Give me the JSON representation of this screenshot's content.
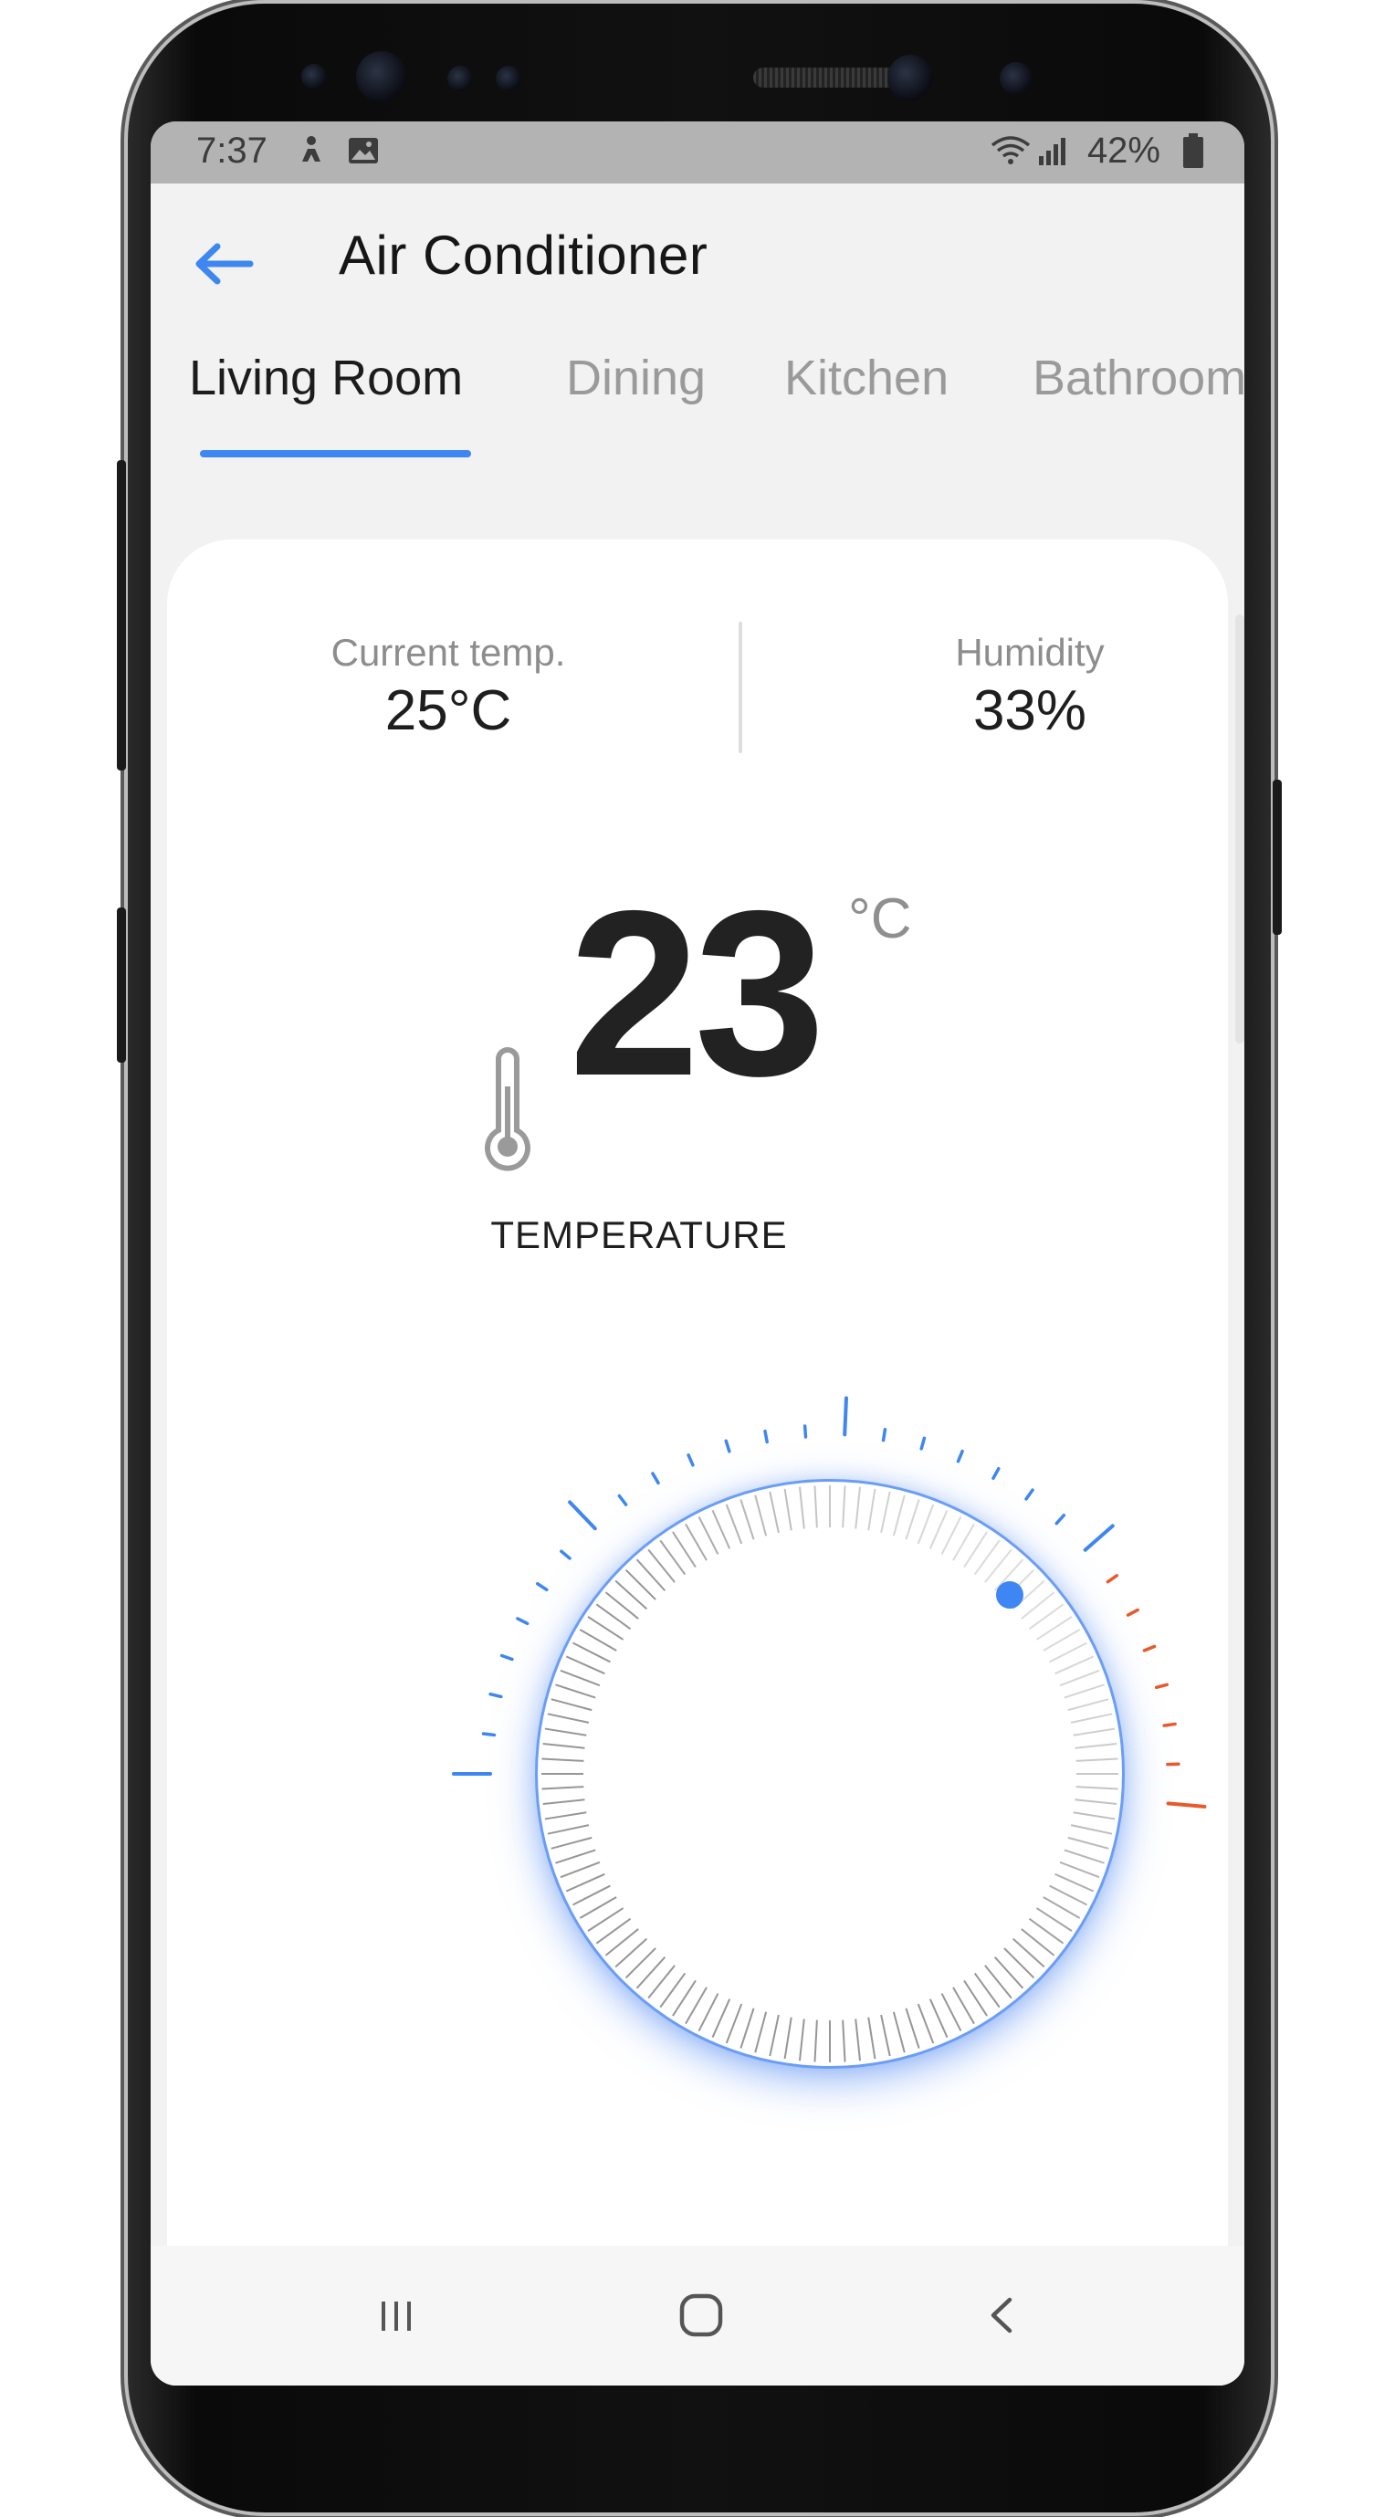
{
  "status_bar": {
    "time": "7:37",
    "battery": "42%"
  },
  "header": {
    "title": "Air Conditioner",
    "back_icon": "arrow-left-icon"
  },
  "tabs": [
    {
      "label": "Living Room",
      "active": true
    },
    {
      "label": "Dining",
      "active": false
    },
    {
      "label": "Kitchen",
      "active": false
    },
    {
      "label": "Bathroom",
      "active": false
    }
  ],
  "stats": {
    "current_temp": {
      "label": "Current temp.",
      "value": "25°C"
    },
    "humidity": {
      "label": "Humidity",
      "value": "33%"
    }
  },
  "setpoint": {
    "value": "23",
    "unit": "°C",
    "label": "TEMPERATURE"
  },
  "dial": {
    "cool_color": "#3e86f0",
    "warm_color": "#e85a2c"
  },
  "colors": {
    "accent": "#3e86f0",
    "card": "#ffffff",
    "background": "#f2f2f2"
  }
}
